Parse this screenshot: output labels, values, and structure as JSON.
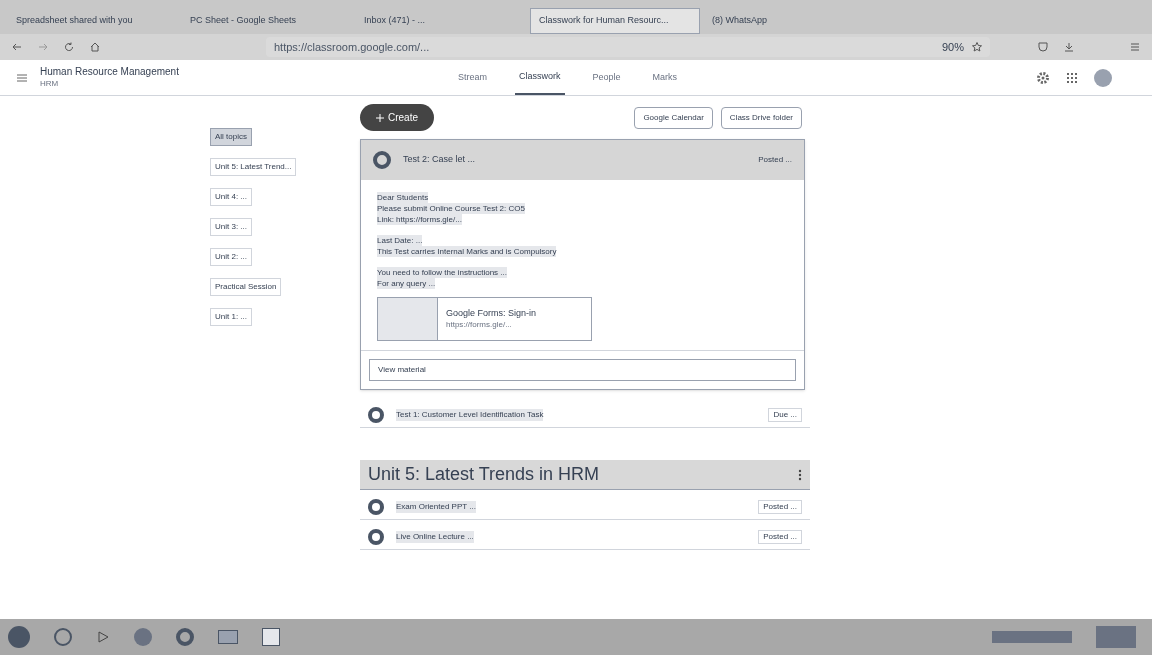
{
  "browser": {
    "tabs": [
      {
        "label": "Spreadsheet shared with you",
        "selected": false
      },
      {
        "label": "PC Sheet - Google Sheets",
        "selected": false
      },
      {
        "label": "Inbox (471) - ...",
        "selected": false
      },
      {
        "label": "Classwork for Human Resourc...",
        "selected": true
      },
      {
        "label": "(8) WhatsApp",
        "selected": false
      }
    ],
    "url": "https://classroom.google.com/...",
    "zoom": "90%"
  },
  "header": {
    "course": "Human Resource Management",
    "section": "HRM",
    "nav": [
      {
        "label": "Stream",
        "selected": false
      },
      {
        "label": "Classwork",
        "selected": true
      },
      {
        "label": "People",
        "selected": false
      },
      {
        "label": "Marks",
        "selected": false
      }
    ]
  },
  "toolbar": {
    "create": "Create",
    "links": [
      "Google Calendar",
      "Class Drive folder"
    ]
  },
  "topics": [
    {
      "label": "All topics",
      "selected": true
    },
    {
      "label": "Unit 5: Latest Trend...",
      "selected": false
    },
    {
      "label": "Unit 4: ...",
      "selected": false
    },
    {
      "label": "Unit 3: ...",
      "selected": false
    },
    {
      "label": "Unit 2: ...",
      "selected": false
    },
    {
      "label": "Practical Session",
      "selected": false
    },
    {
      "label": "Unit 1: ...",
      "selected": false
    }
  ],
  "expanded_item": {
    "title": "Test 2: Case let ...",
    "meta": "Posted ...",
    "paragraphs": [
      [
        "Dear Students",
        "Please submit Online Course Test 2: CO5",
        "Link: https://forms.gle/..."
      ],
      [
        "Last Date: ...",
        "This Test carries Internal Marks and is Compulsory"
      ],
      [
        "You need to follow the instructions ...",
        "For any query ..."
      ]
    ],
    "attachment": {
      "title": "Google Forms: Sign-in",
      "url": "https://forms.gle/..."
    },
    "view": "View material"
  },
  "items_before": [
    {
      "title": "Test 1: Customer Level Identification Task",
      "meta": "Due ..."
    }
  ],
  "section": {
    "title": "Unit 5: Latest Trends in HRM"
  },
  "items_after": [
    {
      "title": "Exam Oriented PPT ...",
      "meta": "Posted ..."
    },
    {
      "title": "Live Online Lecture ...",
      "meta": "Posted ..."
    }
  ]
}
